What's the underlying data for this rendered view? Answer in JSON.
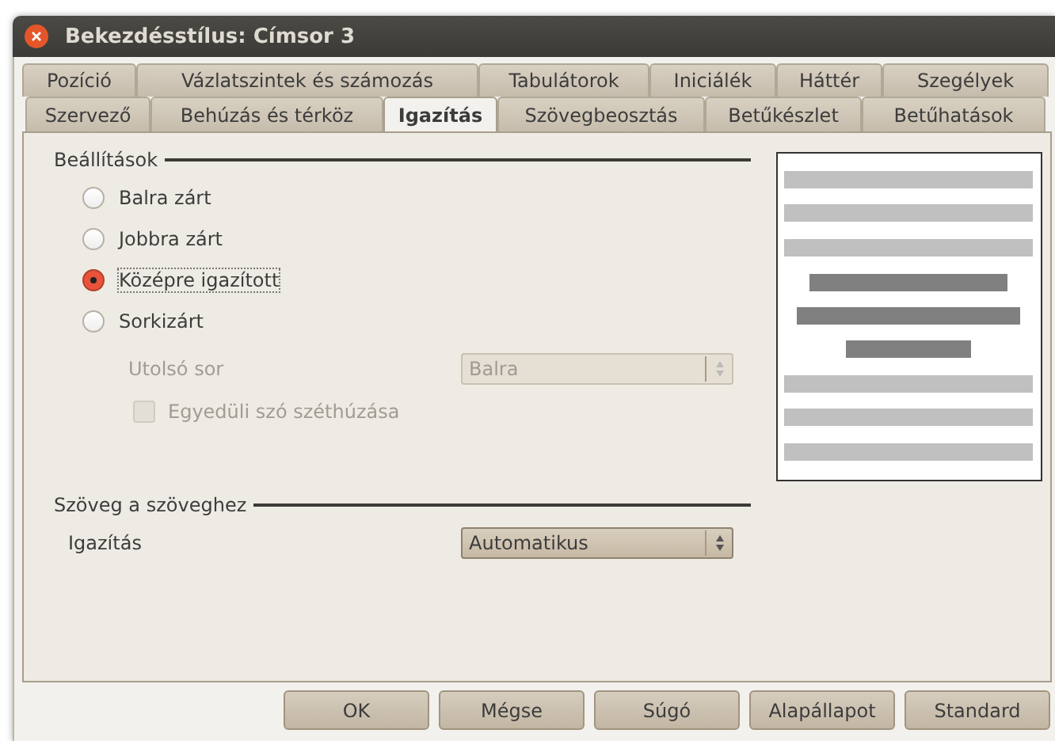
{
  "window": {
    "title": "Bekezdésstílus: Címsor 3"
  },
  "tab_rows": [
    [
      {
        "label": "Pozíció",
        "selected": false
      },
      {
        "label": "Vázlatszintek és számozás",
        "selected": false
      },
      {
        "label": "Tabulátorok",
        "selected": false
      },
      {
        "label": "Iniciálék",
        "selected": false
      },
      {
        "label": "Háttér",
        "selected": false
      },
      {
        "label": "Szegélyek",
        "selected": false
      }
    ],
    [
      {
        "label": "Szervező",
        "selected": false
      },
      {
        "label": "Behúzás és térköz",
        "selected": false
      },
      {
        "label": "Igazítás",
        "selected": true
      },
      {
        "label": "Szövegbeosztás",
        "selected": false
      },
      {
        "label": "Betűkészlet",
        "selected": false
      },
      {
        "label": "Betűhatások",
        "selected": false
      }
    ]
  ],
  "options": {
    "title": "Beállítások",
    "radios": [
      {
        "label": "Balra zárt",
        "selected": false,
        "focused": false
      },
      {
        "label": "Jobbra zárt",
        "selected": false,
        "focused": false
      },
      {
        "label": "Középre igazított",
        "selected": true,
        "focused": true
      },
      {
        "label": "Sorkizárt",
        "selected": false,
        "focused": false
      }
    ],
    "last_line": {
      "label": "Utolsó sor",
      "value": "Balra",
      "disabled": true
    },
    "expand_word": {
      "label": "Egyedüli szó széthúzása",
      "checked": false,
      "disabled": true
    }
  },
  "text_to_text": {
    "title": "Szöveg a szöveghez",
    "alignment": {
      "label": "Igazítás",
      "value": "Automatikus",
      "disabled": false
    }
  },
  "buttons": [
    {
      "label": "OK"
    },
    {
      "label": "Mégse"
    },
    {
      "label": "Súgó"
    },
    {
      "label": "Alapállapot"
    },
    {
      "label": "Standard"
    }
  ]
}
